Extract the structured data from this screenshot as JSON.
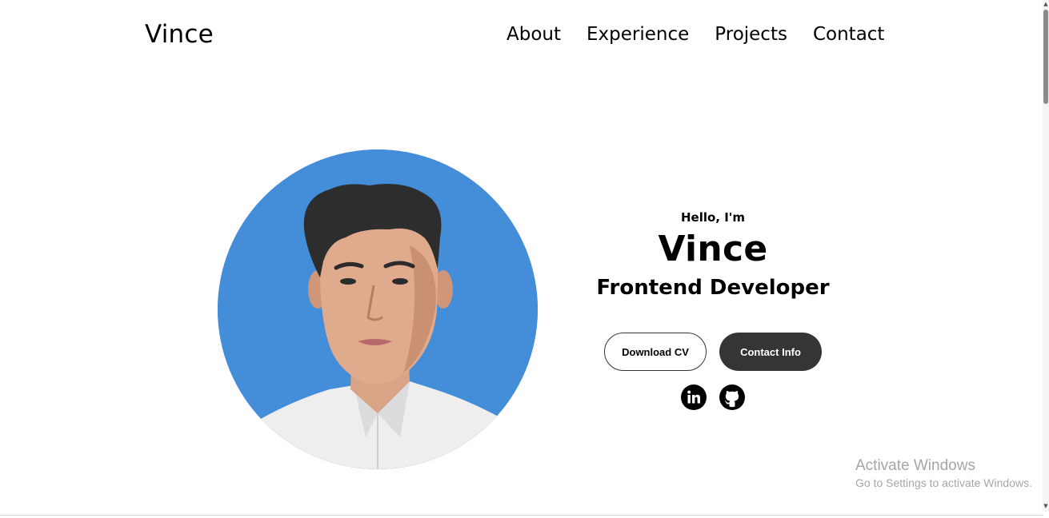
{
  "nav": {
    "logo": "Vince",
    "links": [
      "About",
      "Experience",
      "Projects",
      "Contact"
    ]
  },
  "hero": {
    "greeting": "Hello, I'm",
    "name": "Vince",
    "title": "Frontend Developer",
    "buttons": {
      "download_cv": "Download CV",
      "contact_info": "Contact Info"
    },
    "social": {
      "linkedin_icon": "linkedin-icon",
      "github_icon": "github-icon"
    },
    "profile_bg_color": "#438dd9"
  },
  "watermark": {
    "title": "Activate Windows",
    "subtitle": "Go to Settings to activate Windows."
  },
  "colors": {
    "accent_button": "#353535",
    "text": "#000000"
  }
}
